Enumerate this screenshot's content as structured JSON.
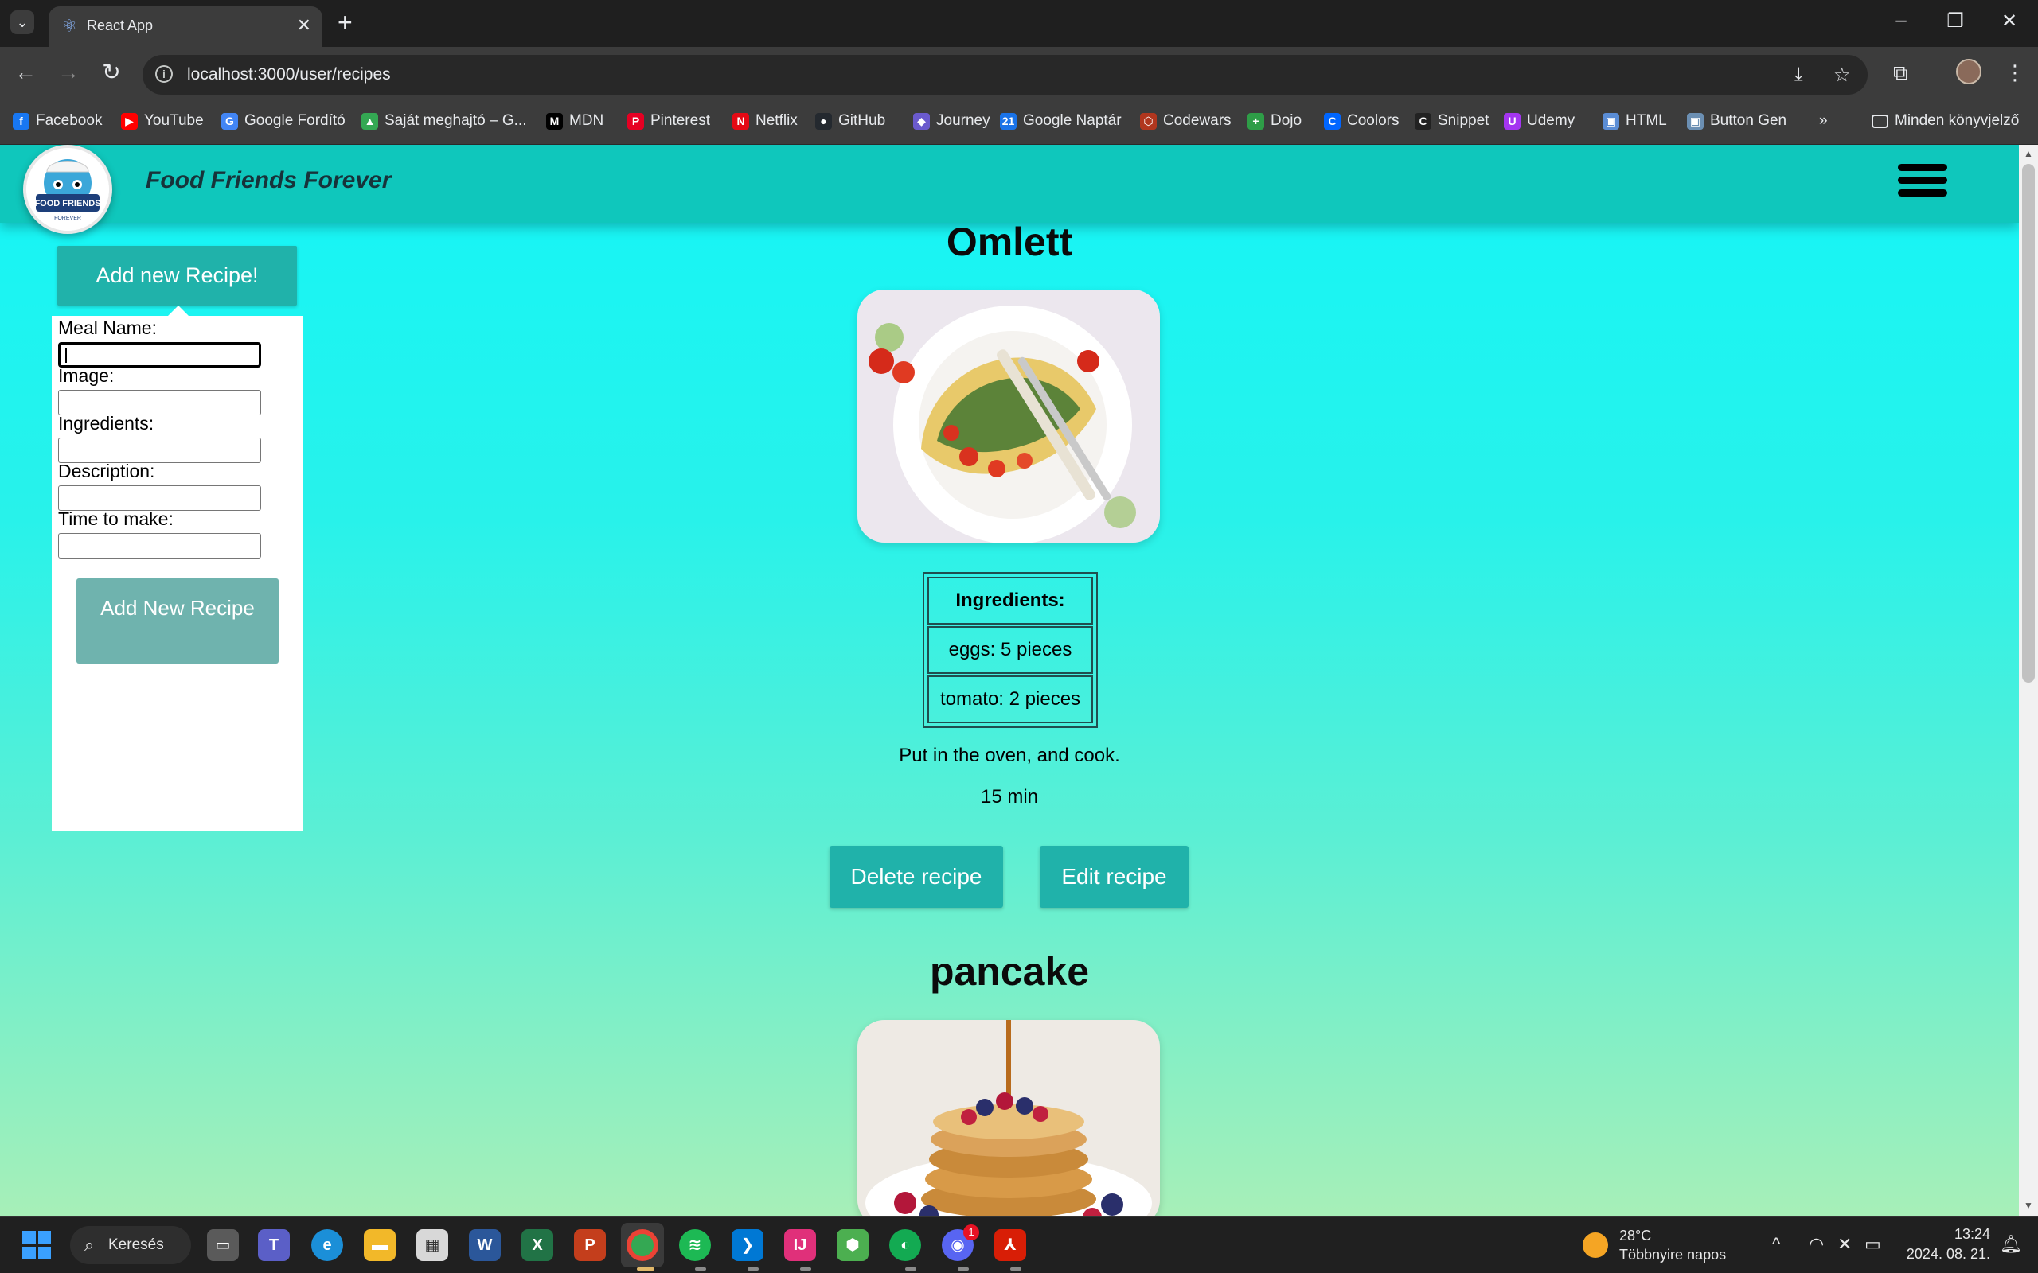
{
  "browser": {
    "tab_title": "React App",
    "url": "localhost:3000/user/recipes",
    "bookmarks": [
      {
        "label": "Facebook",
        "color": "#1877f2",
        "glyph": "f"
      },
      {
        "label": "YouTube",
        "color": "#ff0000",
        "glyph": "▶"
      },
      {
        "label": "Google Fordító",
        "color": "#4285f4",
        "glyph": "G"
      },
      {
        "label": "Saját meghajtó – G...",
        "color": "#34a853",
        "glyph": "▲"
      },
      {
        "label": "MDN",
        "color": "#000000",
        "glyph": "M"
      },
      {
        "label": "Pinterest",
        "color": "#e60023",
        "glyph": "P"
      },
      {
        "label": "Netflix",
        "color": "#e50914",
        "glyph": "N"
      },
      {
        "label": "GitHub",
        "color": "#24292f",
        "glyph": "●"
      },
      {
        "label": "Journey",
        "color": "#6a5acd",
        "glyph": "◆"
      },
      {
        "label": "Google Naptár",
        "color": "#1a73e8",
        "glyph": "21"
      },
      {
        "label": "Codewars",
        "color": "#b1361e",
        "glyph": "⬡"
      },
      {
        "label": "Dojo",
        "color": "#2e9d47",
        "glyph": "+"
      },
      {
        "label": "Coolors",
        "color": "#0066ff",
        "glyph": "C"
      },
      {
        "label": "Snippet",
        "color": "#222222",
        "glyph": "C"
      },
      {
        "label": "Udemy",
        "color": "#a435f0",
        "glyph": "U"
      },
      {
        "label": "HTML",
        "color": "#5a8dd6",
        "glyph": "▣"
      },
      {
        "label": "Button Gen",
        "color": "#6b8fb3",
        "glyph": "▣"
      }
    ],
    "overflow": "»",
    "other_bookmarks": "Minden könyvjelző"
  },
  "app": {
    "brand": "Food Friends Forever",
    "logo_text": "FOOD FRIENDS",
    "logo_sub": "FOREVER"
  },
  "form": {
    "toggle_label": "Add new Recipe!",
    "fields": [
      {
        "label": "Meal Name:",
        "value": ""
      },
      {
        "label": "Image:",
        "value": ""
      },
      {
        "label": "Ingredients:",
        "value": ""
      },
      {
        "label": "Description:",
        "value": ""
      },
      {
        "label": "Time to make:",
        "value": ""
      }
    ],
    "submit_label": "Add New Recipe"
  },
  "recipes": [
    {
      "name": "Omlett",
      "ingredients_header": "Ingredients:",
      "ingredients": [
        "eggs: 5 pieces",
        "tomato: 2 pieces"
      ],
      "description": "Put in the oven, and cook.",
      "time": "15 min",
      "delete_label": "Delete recipe",
      "edit_label": "Edit recipe"
    },
    {
      "name": "pancake"
    }
  ],
  "taskbar": {
    "search_label": "Keresés",
    "weather_temp": "28°C",
    "weather_desc": "Többnyire napos",
    "time": "13:24",
    "date": "2024. 08. 21.",
    "discord_badge": "1"
  }
}
